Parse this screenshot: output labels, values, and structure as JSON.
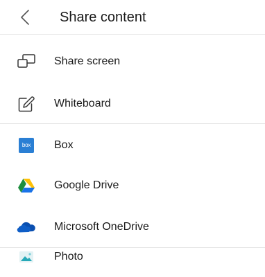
{
  "header": {
    "title": "Share content",
    "back_icon": "chevron-left-icon"
  },
  "sections": [
    {
      "items": [
        {
          "label": "Share screen",
          "icon": "share-screen-icon"
        },
        {
          "label": "Whiteboard",
          "icon": "whiteboard-icon"
        }
      ]
    },
    {
      "items": [
        {
          "label": "Box",
          "icon": "box-icon",
          "logo_text": "box",
          "color": "#2a7fd4"
        },
        {
          "label": "Google Drive",
          "icon": "google-drive-icon"
        },
        {
          "label": "Microsoft OneDrive",
          "icon": "onedrive-icon",
          "color": "#0a4fb0"
        }
      ]
    },
    {
      "items": [
        {
          "label": "Photo",
          "icon": "photo-icon"
        }
      ]
    }
  ]
}
